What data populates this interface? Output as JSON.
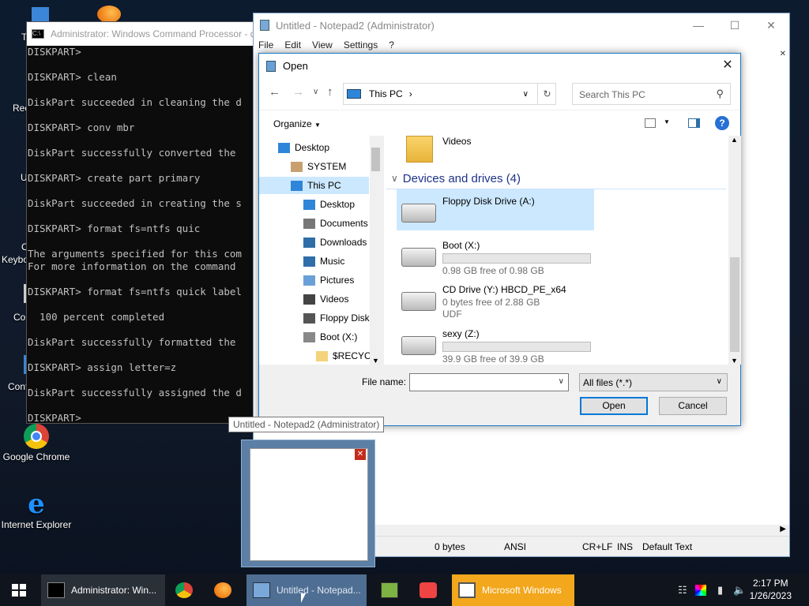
{
  "desktop": {
    "icons": [
      {
        "label": "Google Chrome",
        "icon": "chrome-icon"
      },
      {
        "label": "Internet Explorer",
        "icon": "ie-icon"
      }
    ],
    "partial_labels": [
      "T",
      "Rec",
      "U",
      "C",
      "Keybo",
      "Co",
      "Conf"
    ]
  },
  "cmd": {
    "title": "Administrator: Windows Command Processor - d",
    "lines": [
      "DISKPART>",
      "",
      "DISKPART> clean",
      "",
      "DiskPart succeeded in cleaning the d",
      "",
      "DISKPART> conv mbr",
      "",
      "DiskPart successfully converted the",
      "",
      "DISKPART> create part primary",
      "",
      "DiskPart succeeded in creating the s",
      "",
      "DISKPART> format fs=ntfs quic",
      "",
      "The arguments specified for this com",
      "For more information on the command",
      "",
      "DISKPART> format fs=ntfs quick label",
      "",
      "  100 percent completed",
      "",
      "DiskPart successfully formatted the",
      "",
      "DISKPART> assign letter=z",
      "",
      "DiskPart successfully assigned the d",
      "",
      "DISKPART>"
    ]
  },
  "notepad": {
    "title": "Untitled - Notepad2 (Administrator)",
    "menu": [
      "File",
      "Edit",
      "View",
      "Settings",
      "?"
    ],
    "status": {
      "size": "0 bytes",
      "encoding": "ANSI",
      "eol": "CR+LF",
      "ovr": "INS",
      "scheme": "Default Text"
    }
  },
  "dialog": {
    "title": "Open",
    "address": "This PC",
    "search_placeholder": "Search This PC",
    "organize": "Organize",
    "nav": [
      {
        "label": "Desktop",
        "indent": 0
      },
      {
        "label": "SYSTEM",
        "indent": 1
      },
      {
        "label": "This PC",
        "indent": 1,
        "selected": true
      },
      {
        "label": "Desktop",
        "indent": 2
      },
      {
        "label": "Documents",
        "indent": 2
      },
      {
        "label": "Downloads",
        "indent": 2
      },
      {
        "label": "Music",
        "indent": 2
      },
      {
        "label": "Pictures",
        "indent": 2
      },
      {
        "label": "Videos",
        "indent": 2
      },
      {
        "label": "Floppy Disk Dri",
        "indent": 2
      },
      {
        "label": "Boot (X:)",
        "indent": 2
      },
      {
        "label": "$RECYCLE.BI",
        "indent": 3
      }
    ],
    "partial_folder": "Videos",
    "group_header": "Devices and drives (4)",
    "drives": [
      {
        "name": "Floppy Disk Drive (A:)",
        "free": "",
        "extra": "",
        "selected": true,
        "bar": false
      },
      {
        "name": "Boot (X:)",
        "free": "0.98 GB free of 0.98 GB",
        "extra": "",
        "selected": false,
        "bar": true
      },
      {
        "name": "CD Drive (Y:) HBCD_PE_x64",
        "free": "0 bytes free of 2.88 GB",
        "extra": "UDF",
        "selected": false,
        "bar": false
      },
      {
        "name": "sexy (Z:)",
        "free": "39.9 GB free of 39.9 GB",
        "extra": "",
        "selected": false,
        "bar": true
      }
    ],
    "filename_label": "File name:",
    "filename_value": "",
    "filter": "All files (*.*)",
    "open_label": "Open",
    "cancel_label": "Cancel"
  },
  "tooltip": "Untitled - Notepad2 (Administrator)",
  "taskbar": {
    "items": [
      {
        "label": "Administrator: Win...",
        "icon": "cmd-icon"
      },
      {
        "label": "",
        "icon": "chrome-icon"
      },
      {
        "label": "",
        "icon": "firefox-icon"
      },
      {
        "label": "Untitled - Notepad...",
        "icon": "notepad-icon",
        "active": true
      },
      {
        "label": "",
        "icon": "app-icon"
      },
      {
        "label": "",
        "icon": "app2-icon"
      },
      {
        "label": "Microsoft Windows",
        "icon": "window-icon",
        "highlight": true
      }
    ],
    "time": "2:17 PM",
    "date": "1/26/2023"
  },
  "colors": {
    "accent": "#0078d7",
    "selection": "#cce8ff",
    "highlight_task": "#f2a71c"
  }
}
